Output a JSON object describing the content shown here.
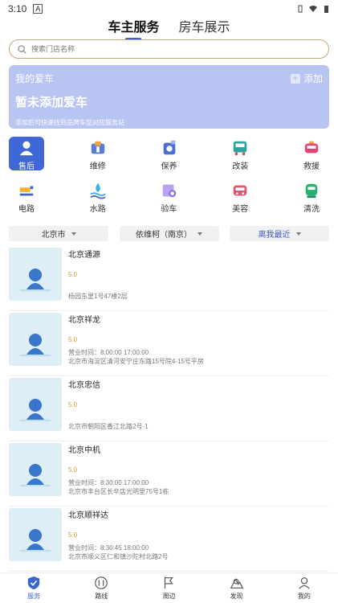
{
  "status_bar": {
    "time": "3:10",
    "a_label": "A"
  },
  "top_tabs": [
    {
      "label": "车主服务",
      "active": true
    },
    {
      "label": "房车展示",
      "active": false
    }
  ],
  "search": {
    "placeholder": "搜索门店名称"
  },
  "my_car": {
    "header": "我的爱车",
    "add_label": "添加",
    "title": "暂未添加爱车",
    "subtitle": "添加后可快速找到品牌车型对应服务站"
  },
  "categories": [
    {
      "label": "售后",
      "icon": "service-person-icon",
      "active": true
    },
    {
      "label": "维修",
      "icon": "wrench-icon",
      "active": false
    },
    {
      "label": "保养",
      "icon": "oil-can-icon",
      "active": false
    },
    {
      "label": "改装",
      "icon": "bus-icon",
      "active": false
    },
    {
      "label": "救援",
      "icon": "rescue-car-icon",
      "active": false
    },
    {
      "label": "电路",
      "icon": "circuit-icon",
      "active": false
    },
    {
      "label": "水路",
      "icon": "water-icon",
      "active": false
    },
    {
      "label": "验车",
      "icon": "inspect-icon",
      "active": false
    },
    {
      "label": "美容",
      "icon": "beauty-car-icon",
      "active": false
    },
    {
      "label": "清洗",
      "icon": "wash-icon",
      "active": false
    }
  ],
  "filters": [
    {
      "label": "北京市"
    },
    {
      "label": "依维柯（南京）"
    },
    {
      "label": "离我最近"
    }
  ],
  "shops": [
    {
      "name": "北京通源",
      "score": "5.0",
      "hours": "",
      "address": "杨园东里1号47楼2层"
    },
    {
      "name": "北京祥龙",
      "score": "5.0",
      "hours": "营业时间：8:00:00 17:00:00",
      "address": "北京市海淀区清河安宁庄东路15号院4-15号平房"
    },
    {
      "name": "北京忠信",
      "score": "5.0",
      "hours": "",
      "address": "北京市朝阳区香江北路2号-1"
    },
    {
      "name": "北京中机",
      "score": "5.0",
      "hours": "营业时间：8:30:00 17:00:00",
      "address": "北京市丰台区长辛店光明里75号1栋"
    },
    {
      "name": "北京顺祥达",
      "score": "5.0",
      "hours": "营业时间：8:30:45 18:00:00",
      "address": "北京市顺义区仁和镇沙陀村北路2号"
    }
  ],
  "bottom_tabs": [
    {
      "label": "服务",
      "icon": "shield-icon",
      "active": true
    },
    {
      "label": "路线",
      "icon": "route-icon",
      "active": false
    },
    {
      "label": "周边",
      "icon": "flag-icon",
      "active": false
    },
    {
      "label": "发现",
      "icon": "discover-icon",
      "active": false
    },
    {
      "label": "我的",
      "icon": "user-icon",
      "active": false
    }
  ],
  "colors": {
    "accent": "#3f67d6",
    "card_bg": "#b8c4f2",
    "score": "#d29a2b",
    "search_border": "#c6a47a"
  }
}
